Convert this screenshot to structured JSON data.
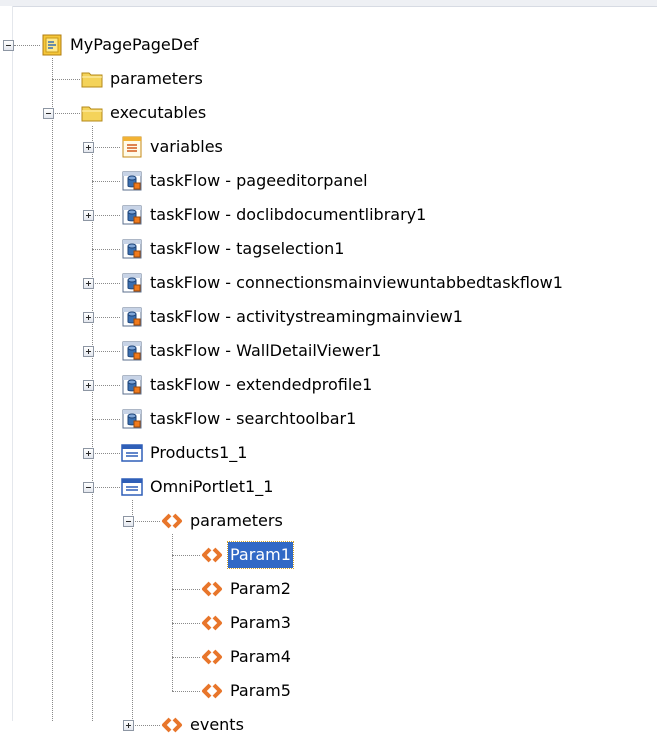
{
  "tree": {
    "nodes": [
      {
        "id": "root",
        "label": "MyPagePageDef",
        "depth": 0,
        "icon": "page-def-icon",
        "expander": "minus"
      },
      {
        "id": "parameters",
        "label": "parameters",
        "depth": 1,
        "icon": "folder-icon",
        "expander": "none",
        "last": false
      },
      {
        "id": "executables",
        "label": "executables",
        "depth": 1,
        "icon": "folder-icon",
        "expander": "minus",
        "last": true
      },
      {
        "id": "variables",
        "label": "variables",
        "depth": 2,
        "icon": "variables-icon",
        "expander": "plus",
        "last": false
      },
      {
        "id": "tf-pageeditorpanel",
        "label": "taskFlow - pageeditorpanel",
        "depth": 2,
        "icon": "taskflow-icon",
        "expander": "none",
        "last": false
      },
      {
        "id": "tf-doclibdocumentlibrary1",
        "label": "taskFlow - doclibdocumentlibrary1",
        "depth": 2,
        "icon": "taskflow-icon",
        "expander": "plus",
        "last": false
      },
      {
        "id": "tf-tagselection1",
        "label": "taskFlow - tagselection1",
        "depth": 2,
        "icon": "taskflow-icon",
        "expander": "none",
        "last": false
      },
      {
        "id": "tf-connectionsmainviewuntabbedtaskflow1",
        "label": "taskFlow - connectionsmainviewuntabbedtaskflow1",
        "depth": 2,
        "icon": "taskflow-icon",
        "expander": "plus",
        "last": false
      },
      {
        "id": "tf-activitystreamingmainview1",
        "label": "taskFlow - activitystreamingmainview1",
        "depth": 2,
        "icon": "taskflow-icon",
        "expander": "plus",
        "last": false
      },
      {
        "id": "tf-walldetailviewer1",
        "label": "taskFlow - WallDetailViewer1",
        "depth": 2,
        "icon": "taskflow-icon",
        "expander": "plus",
        "last": false
      },
      {
        "id": "tf-extendedprofile1",
        "label": "taskFlow - extendedprofile1",
        "depth": 2,
        "icon": "taskflow-icon",
        "expander": "plus",
        "last": false
      },
      {
        "id": "tf-searchtoolbar1",
        "label": "taskFlow - searchtoolbar1",
        "depth": 2,
        "icon": "taskflow-icon",
        "expander": "none",
        "last": false
      },
      {
        "id": "products1-1",
        "label": "Products1_1",
        "depth": 2,
        "icon": "portlet-icon",
        "expander": "plus",
        "last": false
      },
      {
        "id": "omniportlet1-1",
        "label": "OmniPortlet1_1",
        "depth": 2,
        "icon": "portlet-icon",
        "expander": "minus",
        "last": false
      },
      {
        "id": "op-parameters",
        "label": "parameters",
        "depth": 3,
        "icon": "parameter-icon",
        "expander": "minus",
        "last": false
      },
      {
        "id": "param1",
        "label": "Param1",
        "depth": 4,
        "icon": "parameter-icon",
        "expander": "none",
        "last": false,
        "selected": true
      },
      {
        "id": "param2",
        "label": "Param2",
        "depth": 4,
        "icon": "parameter-icon",
        "expander": "none",
        "last": false
      },
      {
        "id": "param3",
        "label": "Param3",
        "depth": 4,
        "icon": "parameter-icon",
        "expander": "none",
        "last": false
      },
      {
        "id": "param4",
        "label": "Param4",
        "depth": 4,
        "icon": "parameter-icon",
        "expander": "none",
        "last": false
      },
      {
        "id": "param5",
        "label": "Param5",
        "depth": 4,
        "icon": "parameter-icon",
        "expander": "none",
        "last": true
      },
      {
        "id": "op-events",
        "label": "events",
        "depth": 3,
        "icon": "parameter-icon",
        "expander": "plus",
        "last": true
      }
    ]
  },
  "colors": {
    "selection": "#3169c6",
    "selection_text": "#ffffff",
    "folder": "#f4d35a",
    "parameter": "#e8762b",
    "portlet": "#2f5fb8",
    "taskflow": "#3a6fb0"
  }
}
